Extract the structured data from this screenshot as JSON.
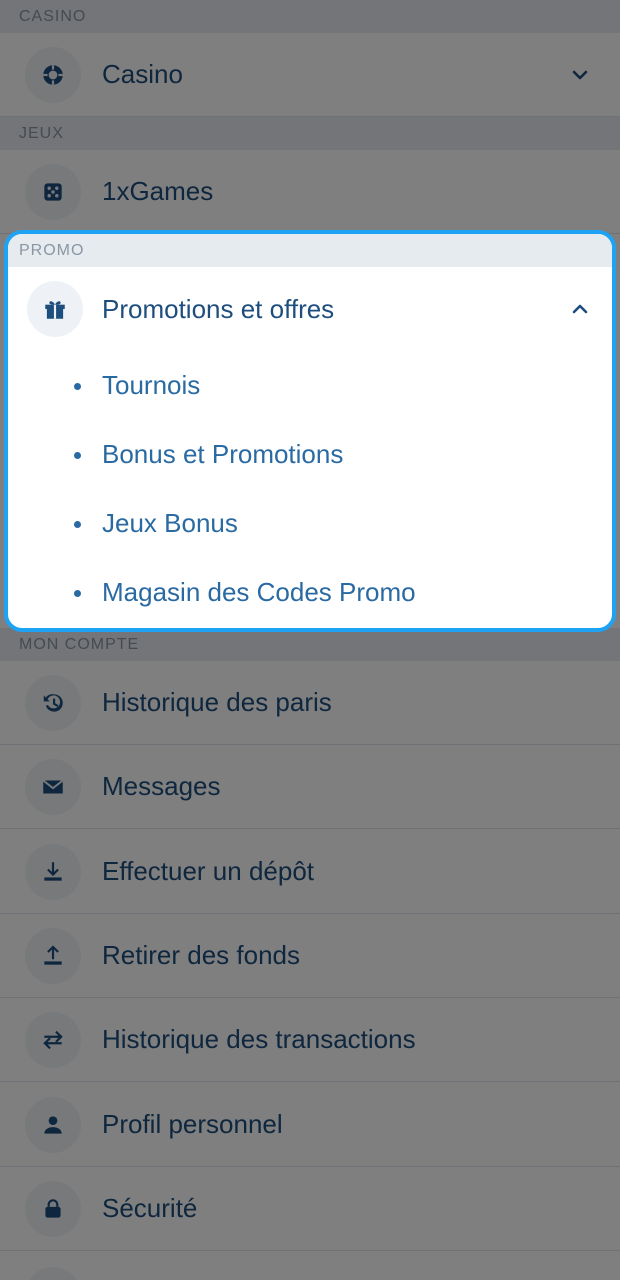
{
  "sections": {
    "casino": {
      "header": "CASINO",
      "item": "Casino",
      "icon": "casino-chip-icon"
    },
    "jeux": {
      "header": "JEUX",
      "item": "1xGames",
      "icon": "dice-icon"
    },
    "promo": {
      "header": "PROMO",
      "item": "Promotions et offres",
      "icon": "gift-icon",
      "subitems": [
        "Tournois",
        "Bonus et Promotions",
        "Jeux Bonus",
        "Magasin des Codes Promo"
      ]
    },
    "account": {
      "header": "MON COMPTE",
      "items": [
        {
          "label": "Historique des paris",
          "icon": "history-icon"
        },
        {
          "label": "Messages",
          "icon": "envelope-icon"
        },
        {
          "label": "Effectuer un dépôt",
          "icon": "download-icon"
        },
        {
          "label": "Retirer des fonds",
          "icon": "upload-icon"
        },
        {
          "label": "Historique des transactions",
          "icon": "transfer-arrows-icon"
        },
        {
          "label": "Profil personnel",
          "icon": "user-icon"
        },
        {
          "label": "Sécurité",
          "icon": "lock-icon"
        }
      ]
    }
  },
  "colors": {
    "accent": "#1ea3f4",
    "text": "#1e4e7d",
    "subtext": "#2a6aa3",
    "header_bg": "#e6ebf0"
  }
}
